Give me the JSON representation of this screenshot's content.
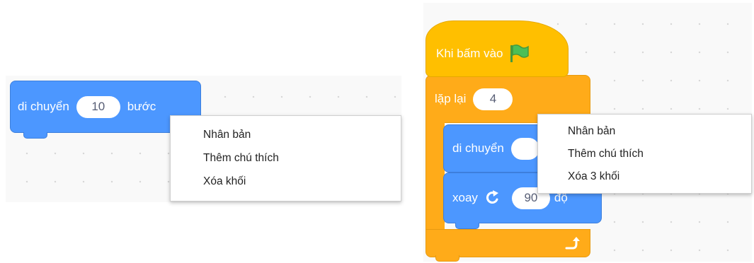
{
  "left_panel": {
    "move_block": {
      "label": "di chuyển",
      "steps": "10",
      "unit": "bước"
    },
    "context_menu": {
      "items": [
        "Nhân bản",
        "Thêm chú thích",
        "Xóa khối"
      ]
    }
  },
  "right_panel": {
    "hat_block": {
      "label": "Khi bấm vào",
      "icon": "green-flag-icon",
      "flag_color": "#4cbf56"
    },
    "repeat_block": {
      "label": "lặp lại",
      "times": "4"
    },
    "move_block": {
      "label": "di chuyển"
    },
    "turn_block": {
      "label": "xoay",
      "icon": "rotate-clockwise-icon",
      "degrees": "90",
      "unit": "độ"
    },
    "loop_arrow_icon": "loop-arrow-icon",
    "context_menu": {
      "items": [
        "Nhân bản",
        "Thêm chú thích",
        "Xóa 3 khối"
      ]
    }
  },
  "colors": {
    "motion_blue": "#4c97ff",
    "events_yellow": "#ffbf00",
    "control_orange": "#ffab19"
  }
}
